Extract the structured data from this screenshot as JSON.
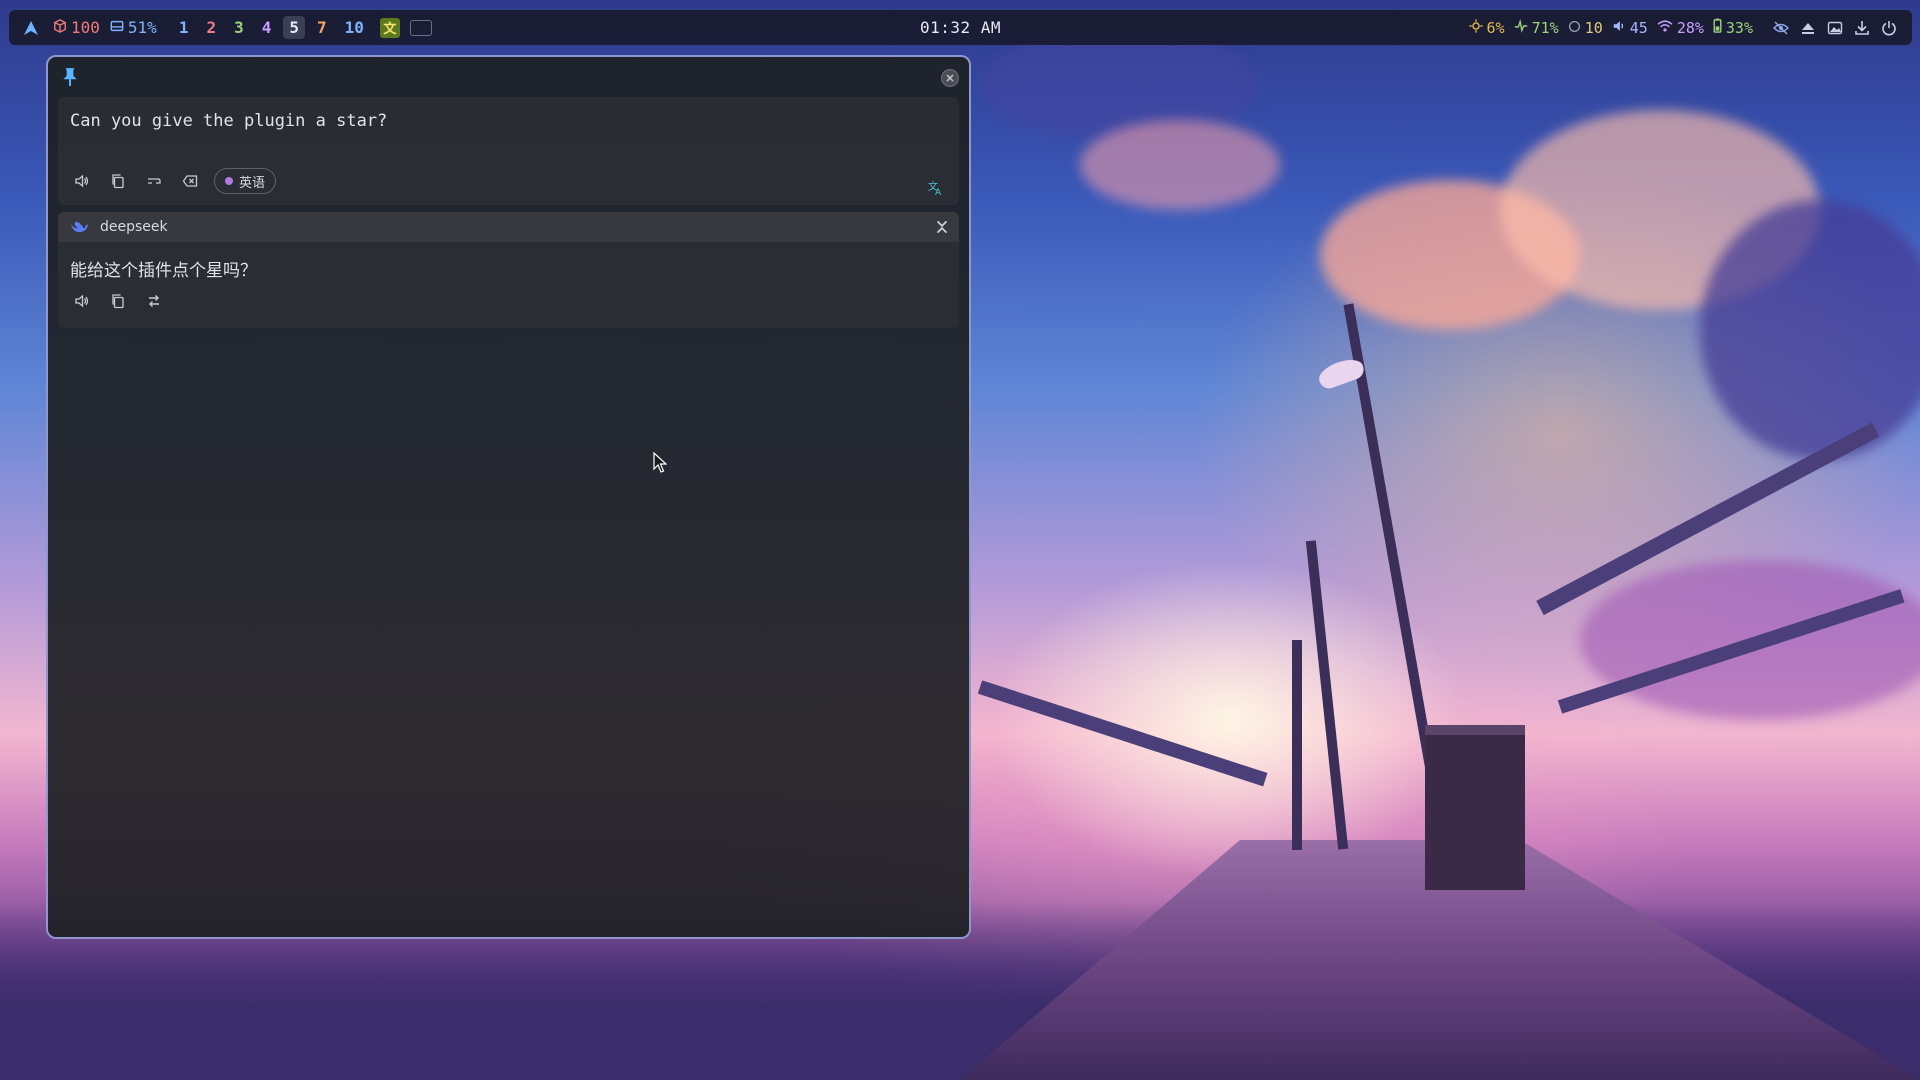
{
  "topbar": {
    "cpu_value": "100",
    "disk_value": "51%",
    "workspaces": [
      "1",
      "2",
      "3",
      "4",
      "5",
      "7",
      "10"
    ],
    "active_workspace": "5",
    "clock": "01:32 AM",
    "tray_ime": "文",
    "brightness": "6%",
    "battery_charge": "71%",
    "notifications": "10",
    "volume": "45",
    "wifi": "28%",
    "battery": "33%"
  },
  "colors": {
    "cpu": "#f07a7a",
    "disk": "#7fb2ff",
    "ws1": "#7fb2ff",
    "ws2": "#f07a8c",
    "ws3": "#9ad27a",
    "ws4": "#c8a0ff",
    "ws7": "#f4a66a",
    "ws10": "#7fb2ff",
    "brightness": "#e8b84e",
    "battery_charge": "#9ad27a",
    "notifications": "#e5c97a",
    "volume": "#a7b8ff",
    "wifi": "#c8a0ff",
    "battery": "#9ad27a",
    "window_border": "#8e98cc",
    "language_dot": "#b07be0"
  },
  "translator": {
    "source_text": "Can you give the plugin a star?",
    "detected_language": "英语",
    "service_name": "deepseek",
    "result_text": "能给这个插件点个星吗？"
  },
  "icons": {
    "pin": "pin-icon",
    "close": "close-icon",
    "speak": "speaker-icon",
    "copy": "copy-icon",
    "wrap": "wrap-icon",
    "clear": "backspace-icon",
    "translate": "translate-icon",
    "service": "deepseek-logo-icon",
    "collapse": "collapse-icon",
    "retranslate": "swap-icon"
  }
}
